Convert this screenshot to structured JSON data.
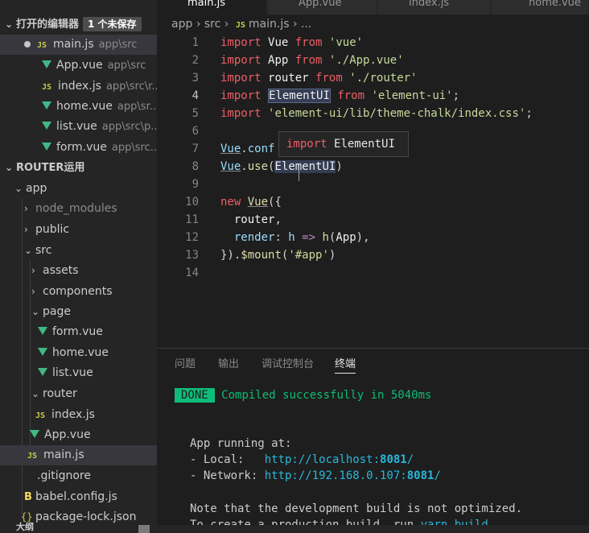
{
  "tabs": [
    {
      "label": "main.js",
      "active": true
    },
    {
      "label": "App.vue",
      "active": false
    },
    {
      "label": "index.js",
      "active": false
    },
    {
      "label": "home.vue",
      "active": false
    }
  ],
  "sidebar": {
    "open_editors": {
      "title": "打开的编辑器",
      "badge": "1 个未保存"
    },
    "open_files": [
      {
        "name": "main.js",
        "desc": "app\\src",
        "type": "js"
      },
      {
        "name": "App.vue",
        "desc": "app\\src",
        "type": "vue"
      },
      {
        "name": "index.js",
        "desc": "app\\src\\r...",
        "type": "js"
      },
      {
        "name": "home.vue",
        "desc": "app\\sr...",
        "type": "vue"
      },
      {
        "name": "list.vue",
        "desc": "app\\src\\p...",
        "type": "vue"
      },
      {
        "name": "form.vue",
        "desc": "app\\src...",
        "type": "vue"
      }
    ],
    "project": {
      "title": "ROUTER运用"
    },
    "tree": [
      {
        "name": "app",
        "type": "folder-open"
      },
      {
        "name": "node_modules",
        "type": "folder"
      },
      {
        "name": "public",
        "type": "folder"
      },
      {
        "name": "src",
        "type": "folder-open"
      },
      {
        "name": "assets",
        "type": "folder"
      },
      {
        "name": "components",
        "type": "folder"
      },
      {
        "name": "page",
        "type": "folder-open"
      },
      {
        "name": "form.vue",
        "type": "vue"
      },
      {
        "name": "home.vue",
        "type": "vue"
      },
      {
        "name": "list.vue",
        "type": "vue"
      },
      {
        "name": "router",
        "type": "folder-open"
      },
      {
        "name": "index.js",
        "type": "js"
      },
      {
        "name": "App.vue",
        "type": "vue"
      },
      {
        "name": "main.js",
        "type": "js"
      },
      {
        "name": ".gitignore",
        "type": "git"
      },
      {
        "name": "babel.config.js",
        "type": "babel"
      },
      {
        "name": "package-lock.json",
        "type": "json"
      }
    ],
    "outline_title": "大纲"
  },
  "breadcrumb": {
    "p1": "app",
    "p2": "src",
    "p3": "main.js",
    "p4": "..."
  },
  "icons": {
    "js": "JS",
    "json": "{}",
    "babel": "B"
  },
  "editor": {
    "line_numbers": [
      "1",
      "2",
      "3",
      "4",
      "5",
      "6",
      "7",
      "8",
      "9",
      "10",
      "11",
      "12",
      "13",
      "14"
    ],
    "active_line": 4,
    "l1": {
      "kw": "import",
      "id": "Vue",
      "from": "from",
      "str": "'vue'"
    },
    "l2": {
      "kw": "import",
      "id": "App",
      "from": "from",
      "str": "'./App.vue'"
    },
    "l3": {
      "kw": "import",
      "id": "router",
      "from": "from",
      "str": "'./router'"
    },
    "l4": {
      "kw": "import",
      "id": "ElementUI",
      "from": "from",
      "str": "'element-ui'",
      "semi": ";"
    },
    "l5": {
      "kw": "import",
      "str": "'element-ui/lib/theme-chalk/index.css'",
      "semi": ";"
    },
    "l7": {
      "obj": "Vue",
      "dot": ".",
      "prop": "conf",
      "val": "false"
    },
    "l8": {
      "obj": "Vue",
      "dot": ".",
      "fn": "use",
      "open": "(",
      "arg": "ElementUI",
      "close": ")"
    },
    "l10": {
      "kw": "new",
      "fn": "Vue",
      "open": "({"
    },
    "l11": {
      "id": "router",
      "comma": ","
    },
    "l12": {
      "key": "render",
      "colon": ": ",
      "param": "h",
      "arrow": "=>",
      "fn": "h",
      "open": "(",
      "arg": "App",
      "close": "),"
    },
    "l13": {
      "close": "})",
      "dot": ".",
      "fn": "$mount",
      "open": "(",
      "str": "'#app'",
      "end": ")"
    },
    "tooltip": {
      "kw": "import",
      "id": "ElementUI"
    }
  },
  "panel": {
    "tabs": [
      "问题",
      "输出",
      "调试控制台",
      "终端"
    ],
    "active_tab": "终端",
    "done": "DONE",
    "compiled": "Compiled successfully in 5040ms",
    "running": "App running at:",
    "local_label": "- Local:   ",
    "local_url": "http://localhost:",
    "local_port": "8081",
    "local_slash": "/",
    "network_label": "- Network: ",
    "network_url": "http://192.168.0.107:",
    "network_port": "8081",
    "network_slash": "/",
    "note1": "Note that the development build is not optimized.",
    "note2_pre": "To create a production build, run ",
    "note2_cmd": "yarn build",
    "note2_post": "."
  }
}
